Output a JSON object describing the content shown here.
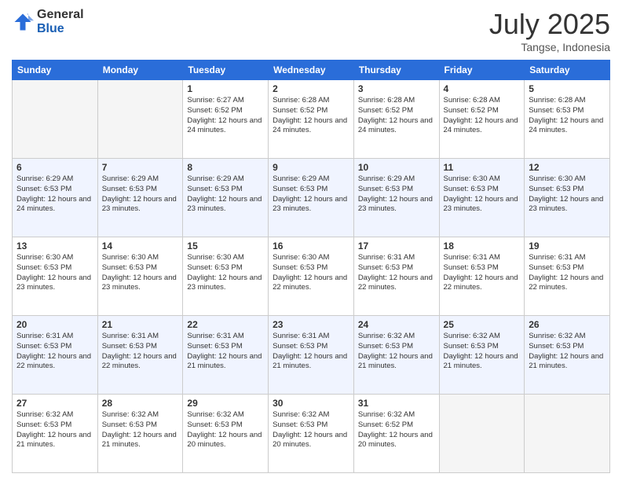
{
  "logo": {
    "general": "General",
    "blue": "Blue"
  },
  "title": "July 2025",
  "subtitle": "Tangse, Indonesia",
  "days_of_week": [
    "Sunday",
    "Monday",
    "Tuesday",
    "Wednesday",
    "Thursday",
    "Friday",
    "Saturday"
  ],
  "weeks": [
    [
      {
        "day": "",
        "info": ""
      },
      {
        "day": "",
        "info": ""
      },
      {
        "day": "1",
        "info": "Sunrise: 6:27 AM\nSunset: 6:52 PM\nDaylight: 12 hours and 24 minutes."
      },
      {
        "day": "2",
        "info": "Sunrise: 6:28 AM\nSunset: 6:52 PM\nDaylight: 12 hours and 24 minutes."
      },
      {
        "day": "3",
        "info": "Sunrise: 6:28 AM\nSunset: 6:52 PM\nDaylight: 12 hours and 24 minutes."
      },
      {
        "day": "4",
        "info": "Sunrise: 6:28 AM\nSunset: 6:52 PM\nDaylight: 12 hours and 24 minutes."
      },
      {
        "day": "5",
        "info": "Sunrise: 6:28 AM\nSunset: 6:53 PM\nDaylight: 12 hours and 24 minutes."
      }
    ],
    [
      {
        "day": "6",
        "info": "Sunrise: 6:29 AM\nSunset: 6:53 PM\nDaylight: 12 hours and 24 minutes."
      },
      {
        "day": "7",
        "info": "Sunrise: 6:29 AM\nSunset: 6:53 PM\nDaylight: 12 hours and 23 minutes."
      },
      {
        "day": "8",
        "info": "Sunrise: 6:29 AM\nSunset: 6:53 PM\nDaylight: 12 hours and 23 minutes."
      },
      {
        "day": "9",
        "info": "Sunrise: 6:29 AM\nSunset: 6:53 PM\nDaylight: 12 hours and 23 minutes."
      },
      {
        "day": "10",
        "info": "Sunrise: 6:29 AM\nSunset: 6:53 PM\nDaylight: 12 hours and 23 minutes."
      },
      {
        "day": "11",
        "info": "Sunrise: 6:30 AM\nSunset: 6:53 PM\nDaylight: 12 hours and 23 minutes."
      },
      {
        "day": "12",
        "info": "Sunrise: 6:30 AM\nSunset: 6:53 PM\nDaylight: 12 hours and 23 minutes."
      }
    ],
    [
      {
        "day": "13",
        "info": "Sunrise: 6:30 AM\nSunset: 6:53 PM\nDaylight: 12 hours and 23 minutes."
      },
      {
        "day": "14",
        "info": "Sunrise: 6:30 AM\nSunset: 6:53 PM\nDaylight: 12 hours and 23 minutes."
      },
      {
        "day": "15",
        "info": "Sunrise: 6:30 AM\nSunset: 6:53 PM\nDaylight: 12 hours and 23 minutes."
      },
      {
        "day": "16",
        "info": "Sunrise: 6:30 AM\nSunset: 6:53 PM\nDaylight: 12 hours and 22 minutes."
      },
      {
        "day": "17",
        "info": "Sunrise: 6:31 AM\nSunset: 6:53 PM\nDaylight: 12 hours and 22 minutes."
      },
      {
        "day": "18",
        "info": "Sunrise: 6:31 AM\nSunset: 6:53 PM\nDaylight: 12 hours and 22 minutes."
      },
      {
        "day": "19",
        "info": "Sunrise: 6:31 AM\nSunset: 6:53 PM\nDaylight: 12 hours and 22 minutes."
      }
    ],
    [
      {
        "day": "20",
        "info": "Sunrise: 6:31 AM\nSunset: 6:53 PM\nDaylight: 12 hours and 22 minutes."
      },
      {
        "day": "21",
        "info": "Sunrise: 6:31 AM\nSunset: 6:53 PM\nDaylight: 12 hours and 22 minutes."
      },
      {
        "day": "22",
        "info": "Sunrise: 6:31 AM\nSunset: 6:53 PM\nDaylight: 12 hours and 21 minutes."
      },
      {
        "day": "23",
        "info": "Sunrise: 6:31 AM\nSunset: 6:53 PM\nDaylight: 12 hours and 21 minutes."
      },
      {
        "day": "24",
        "info": "Sunrise: 6:32 AM\nSunset: 6:53 PM\nDaylight: 12 hours and 21 minutes."
      },
      {
        "day": "25",
        "info": "Sunrise: 6:32 AM\nSunset: 6:53 PM\nDaylight: 12 hours and 21 minutes."
      },
      {
        "day": "26",
        "info": "Sunrise: 6:32 AM\nSunset: 6:53 PM\nDaylight: 12 hours and 21 minutes."
      }
    ],
    [
      {
        "day": "27",
        "info": "Sunrise: 6:32 AM\nSunset: 6:53 PM\nDaylight: 12 hours and 21 minutes."
      },
      {
        "day": "28",
        "info": "Sunrise: 6:32 AM\nSunset: 6:53 PM\nDaylight: 12 hours and 21 minutes."
      },
      {
        "day": "29",
        "info": "Sunrise: 6:32 AM\nSunset: 6:53 PM\nDaylight: 12 hours and 20 minutes."
      },
      {
        "day": "30",
        "info": "Sunrise: 6:32 AM\nSunset: 6:53 PM\nDaylight: 12 hours and 20 minutes."
      },
      {
        "day": "31",
        "info": "Sunrise: 6:32 AM\nSunset: 6:52 PM\nDaylight: 12 hours and 20 minutes."
      },
      {
        "day": "",
        "info": ""
      },
      {
        "day": "",
        "info": ""
      }
    ]
  ]
}
